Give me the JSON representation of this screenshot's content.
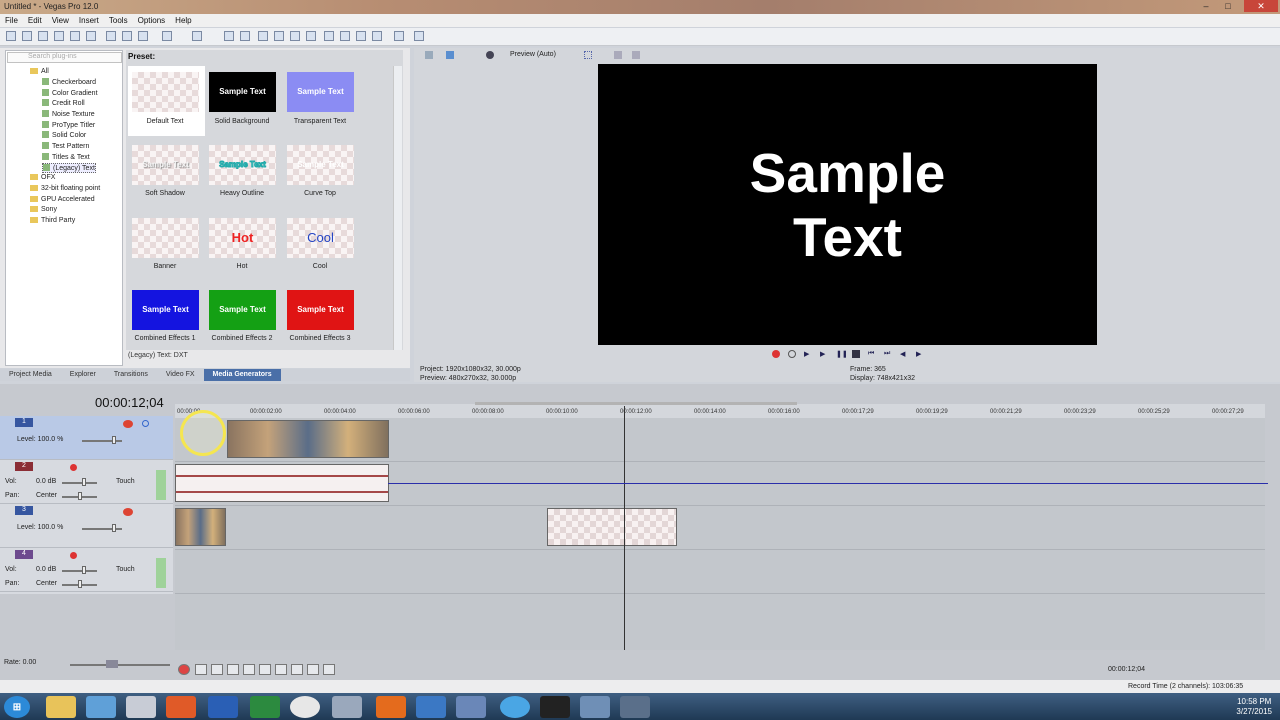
{
  "window": {
    "title": "Untitled * - Vegas Pro 12.0",
    "min": "–",
    "max": "□",
    "close": "✕"
  },
  "menu": [
    "File",
    "Edit",
    "View",
    "Insert",
    "Tools",
    "Options",
    "Help"
  ],
  "plugins": {
    "search_placeholder": "Search plug-ins",
    "tree": [
      "All",
      "Checkerboard",
      "Color Gradient",
      "Credit Roll",
      "Noise Texture",
      "ProType Titler",
      "Solid Color",
      "Test Pattern",
      "Titles & Text",
      "(Legacy) Text",
      "OFX",
      "32-bit floating point",
      "GPU Accelerated",
      "Sony",
      "Third Party"
    ]
  },
  "presets": {
    "label": "Preset:",
    "items": [
      {
        "name": "Default Text",
        "thumb": ""
      },
      {
        "name": "Solid Background",
        "thumb": "Sample Text"
      },
      {
        "name": "Transparent Text",
        "thumb": "Sample Text"
      },
      {
        "name": "Soft Shadow",
        "thumb": "Sample Text"
      },
      {
        "name": "Heavy Outline",
        "thumb": "Sample Text"
      },
      {
        "name": "Curve Top",
        "thumb": "Sample Text"
      },
      {
        "name": "Banner",
        "thumb": ""
      },
      {
        "name": "Hot",
        "thumb": "Hot"
      },
      {
        "name": "Cool",
        "thumb": "Cool"
      },
      {
        "name": "Combined Effects 1",
        "thumb": "Sample Text"
      },
      {
        "name": "Combined Effects 2",
        "thumb": "Sample Text"
      },
      {
        "name": "Combined Effects 3",
        "thumb": "Sample Text"
      }
    ],
    "dxt": "(Legacy) Text: DXT"
  },
  "tabs": [
    "Project Media",
    "Explorer",
    "Transitions",
    "Video FX",
    "Media Generators"
  ],
  "preview": {
    "mode": "Preview (Auto)",
    "line1": "Sample",
    "line2": "Text",
    "project": "Project:   1920x1080x32, 30.000p",
    "preview": "Preview:   480x270x32, 30.000p",
    "frame": "Frame:       365",
    "display": "Display:      748x421x32"
  },
  "timeline": {
    "timecode": "00:00:12;04",
    "ticks": [
      "00:00:00",
      "00:00:02:00",
      "00:00:04:00",
      "00:00:06:00",
      "00:00:08:00",
      "00:00:10:00",
      "00:00:12:00",
      "00:00:14:00",
      "00:00:16:00",
      "00:00:17;29",
      "00:00:19;29",
      "00:00:21;29",
      "00:00:23;29",
      "00:00:25;29",
      "00:00:27;29"
    ],
    "tracks": [
      {
        "num": "1",
        "level": "Level: 100.0 %"
      },
      {
        "num": "2",
        "vol": "Vol:",
        "vol_val": "0.0 dB",
        "pan": "Pan:",
        "pan_val": "Center",
        "touch": "Touch"
      },
      {
        "num": "3",
        "level": "Level: 100.0 %"
      },
      {
        "num": "4",
        "vol": "Vol:",
        "vol_val": "0.0 dB",
        "pan": "Pan:",
        "pan_val": "Center",
        "touch": "Touch"
      }
    ],
    "rate": "Rate: 0.00",
    "cursor_tc": "00:00:12;04",
    "record_time": "Record Time (2 channels): 103:06:35"
  },
  "taskbar": {
    "time": "10:58 PM",
    "date": "3/27/2015"
  }
}
